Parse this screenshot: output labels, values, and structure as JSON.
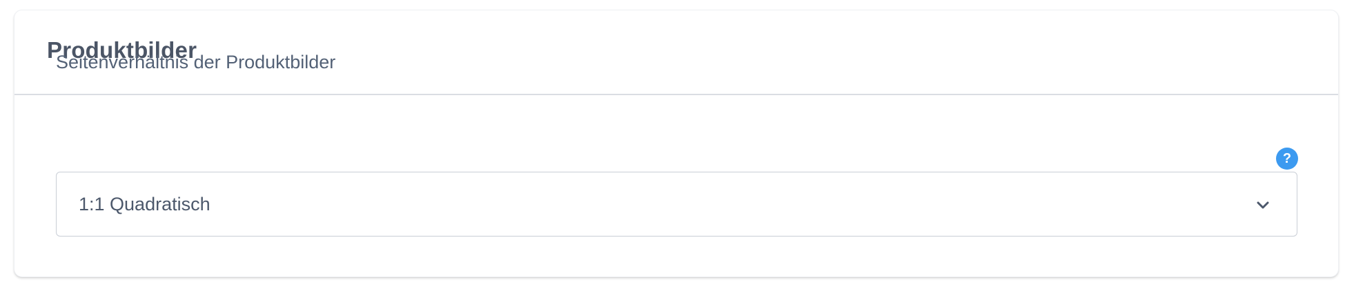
{
  "card": {
    "title": "Produktbilder"
  },
  "field": {
    "label": "Seitenverhältnis der Produktbilder",
    "help_glyph": "?",
    "selected_value": "1:1 Quadratisch"
  },
  "icons": {
    "help": "question-circle-icon",
    "dropdown": "chevron-down-icon"
  },
  "colors": {
    "title": "#4b5566",
    "label": "#536176",
    "help_icon": "#3c9af0",
    "divider": "#dadde3",
    "select_border": "#c9ced6"
  }
}
